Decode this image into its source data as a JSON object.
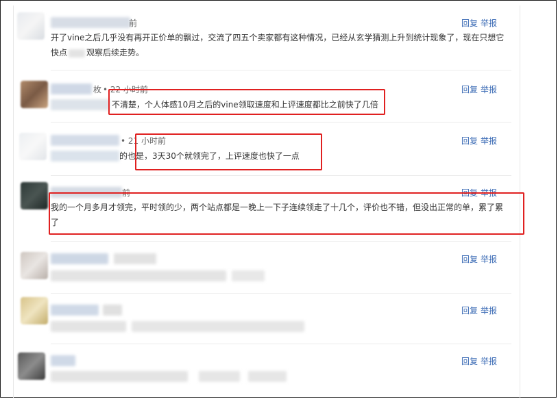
{
  "comments": [
    {
      "time": "前",
      "text": "开了vine之后几乎没有再开正价单的飘过，交流了四五个卖家都有这种情况，已经从玄学猜测上升到统计现象了，现在只想它",
      "text_line2": "快点",
      "text_line2_b": "观察后续走势。",
      "reply": "回复",
      "report": "举报"
    },
    {
      "name_tail": "枚",
      "time": "• 22 小时前",
      "text": "不清楚，个人体感10月之后的vine领取速度和上评速度都比之前快了几倍",
      "reply": "回复",
      "report": "举报"
    },
    {
      "time": "• 21 小时前",
      "text_prefix": "的也是，",
      "text": "3天30个就领完了，上评速度也快了一点",
      "reply": "回复",
      "report": "举报"
    },
    {
      "time": "前",
      "text": "我的一个月多月才领完，平时领的少，两个站点都是一晚上一下子连续领走了十几个，评价也不错，但没出正常的单，累了累",
      "text_line2": "了",
      "reply": "回复",
      "report": "举报"
    },
    {
      "reply": "回复",
      "report": "举报"
    },
    {
      "reply": "回复",
      "report": "举报"
    },
    {
      "reply": "回复",
      "report": "举报"
    }
  ]
}
